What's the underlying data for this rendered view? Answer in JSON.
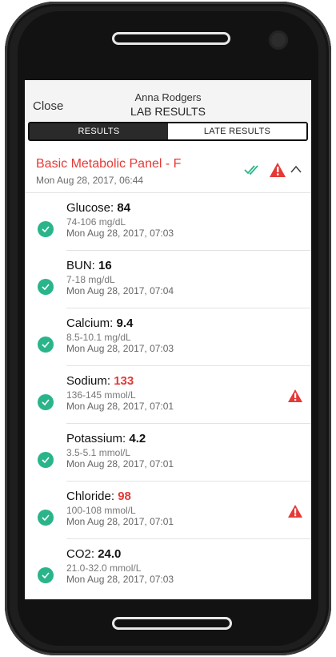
{
  "nav": {
    "close": "Close",
    "patient": "Anna Rodgers",
    "title": "LAB RESULTS"
  },
  "tabs": [
    {
      "label": "RESULTS",
      "active": true
    },
    {
      "label": "LATE RESULTS",
      "active": false
    }
  ],
  "panel": {
    "title": "Basic Metabolic Panel - F",
    "datetime": "Mon Aug 28, 2017, 06:44",
    "icons": [
      "double-check-icon",
      "warning-icon",
      "chevron-up-icon"
    ]
  },
  "results": [
    {
      "name": "Glucose:",
      "value": "84",
      "abnormal": false,
      "range": "74-106 mg/dL",
      "time": "Mon Aug 28, 2017, 07:03"
    },
    {
      "name": "BUN:",
      "value": "16",
      "abnormal": false,
      "range": "7-18 mg/dL",
      "time": "Mon Aug 28, 2017, 07:04"
    },
    {
      "name": "Calcium:",
      "value": "9.4",
      "abnormal": false,
      "range": "8.5-10.1 mg/dL",
      "time": "Mon Aug 28, 2017, 07:03"
    },
    {
      "name": "Sodium:",
      "value": "133",
      "abnormal": true,
      "range": "136-145 mmol/L",
      "time": "Mon Aug 28, 2017, 07:01"
    },
    {
      "name": "Potassium:",
      "value": "4.2",
      "abnormal": false,
      "range": "3.5-5.1 mmol/L",
      "time": "Mon Aug 28, 2017, 07:01"
    },
    {
      "name": "Chloride:",
      "value": "98",
      "abnormal": true,
      "range": "100-108 mmol/L",
      "time": "Mon Aug 28, 2017, 07:01"
    },
    {
      "name": "CO2:",
      "value": "24.0",
      "abnormal": false,
      "range": "21.0-32.0 mmol/L",
      "time": "Mon Aug 28, 2017, 07:03"
    }
  ],
  "colors": {
    "accent_red": "#e53935",
    "check_green": "#2ab48a",
    "tab_active": "#2a2a2a"
  }
}
